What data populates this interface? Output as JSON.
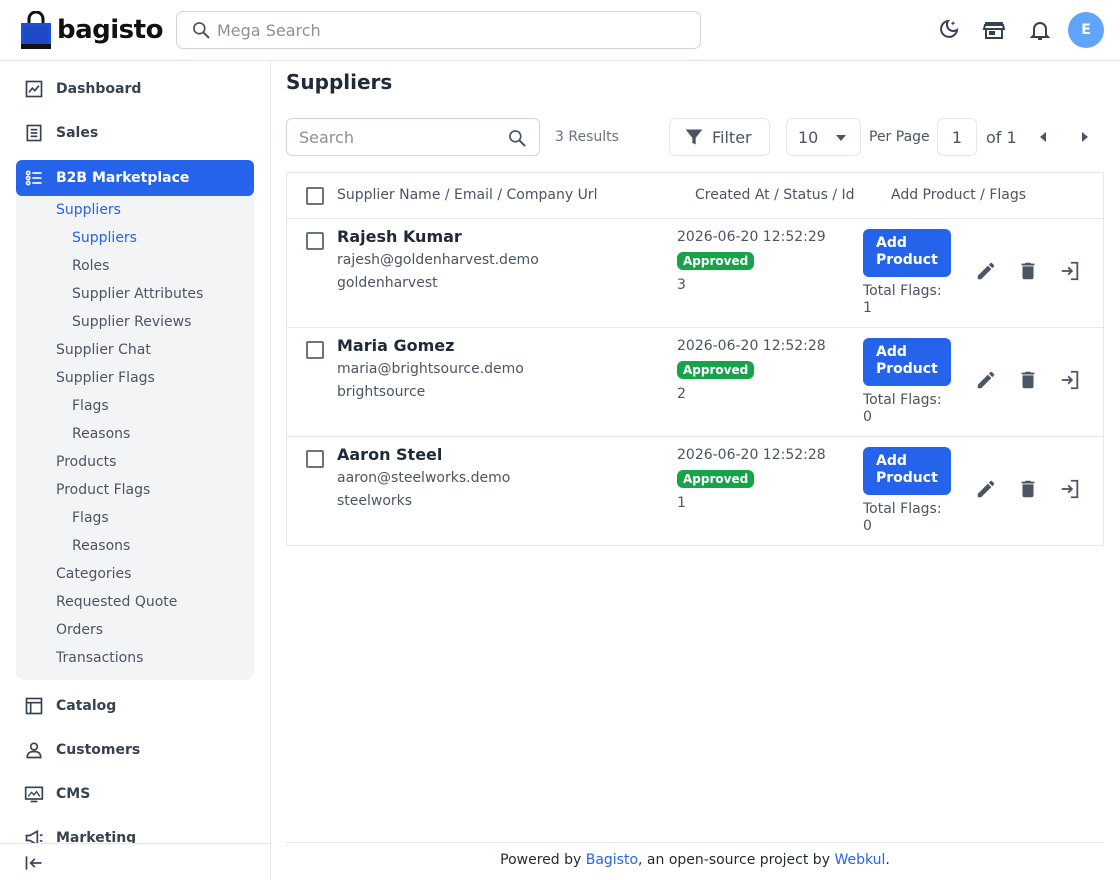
{
  "header": {
    "brand": "bagisto",
    "search_placeholder": "Mega Search",
    "avatar_initial": "E"
  },
  "sidebar": {
    "items": [
      {
        "label": "Dashboard",
        "icon": "dashboard-icon"
      },
      {
        "label": "Sales",
        "icon": "sales-icon"
      },
      {
        "label": "B2B Marketplace",
        "icon": "list-icon",
        "active": true
      },
      {
        "label": "Catalog",
        "icon": "catalog-icon"
      },
      {
        "label": "Customers",
        "icon": "customers-icon"
      },
      {
        "label": "CMS",
        "icon": "cms-icon"
      },
      {
        "label": "Marketing",
        "icon": "marketing-icon"
      }
    ],
    "submenu": [
      {
        "label": "Suppliers",
        "level": 1,
        "active": true
      },
      {
        "label": "Suppliers",
        "level": 2,
        "active": true
      },
      {
        "label": "Roles",
        "level": 2
      },
      {
        "label": "Supplier Attributes",
        "level": 2
      },
      {
        "label": "Supplier Reviews",
        "level": 2
      },
      {
        "label": "Supplier Chat",
        "level": 1
      },
      {
        "label": "Supplier Flags",
        "level": 1
      },
      {
        "label": "Flags",
        "level": 2
      },
      {
        "label": "Reasons",
        "level": 2
      },
      {
        "label": "Products",
        "level": 1
      },
      {
        "label": "Product Flags",
        "level": 1
      },
      {
        "label": "Flags",
        "level": 2
      },
      {
        "label": "Reasons",
        "level": 2
      },
      {
        "label": "Categories",
        "level": 1
      },
      {
        "label": "Requested Quote",
        "level": 1
      },
      {
        "label": "Orders",
        "level": 1
      },
      {
        "label": "Transactions",
        "level": 1
      }
    ]
  },
  "main": {
    "title": "Suppliers",
    "toolbar": {
      "search_placeholder": "Search",
      "results": "3 Results",
      "filter_label": "Filter",
      "per_page_value": "10",
      "per_page_label": "Per Page",
      "page_value": "1",
      "of_label": "of 1"
    },
    "table": {
      "headers": [
        "Supplier Name / Email / Company Url",
        "Created At / Status / Id",
        "Add Product / Flags"
      ],
      "rows": [
        {
          "name": "Rajesh Kumar",
          "email": "rajesh@goldenharvest.demo",
          "company": "goldenharvest",
          "created": "2026-06-20 12:52:29",
          "status": "Approved",
          "id": "3",
          "add_label": "Add Product",
          "flags_label": "Total Flags:",
          "flags": "1"
        },
        {
          "name": "Maria Gomez",
          "email": "maria@brightsource.demo",
          "company": "brightsource",
          "created": "2026-06-20 12:52:28",
          "status": "Approved",
          "id": "2",
          "add_label": "Add Product",
          "flags_label": "Total Flags:",
          "flags": "0"
        },
        {
          "name": "Aaron Steel",
          "email": "aaron@steelworks.demo",
          "company": "steelworks",
          "created": "2026-06-20 12:52:28",
          "status": "Approved",
          "id": "1",
          "add_label": "Add Product",
          "flags_label": "Total Flags:",
          "flags": "0"
        }
      ]
    }
  },
  "footer": {
    "prefix": "Powered by ",
    "link1": "Bagisto",
    "middle": ", an open-source project by ",
    "link2": "Webkul",
    "suffix": "."
  },
  "colors": {
    "accent": "#2563eb",
    "status_approved": "#16a34a",
    "avatar": "#60a5fa"
  }
}
